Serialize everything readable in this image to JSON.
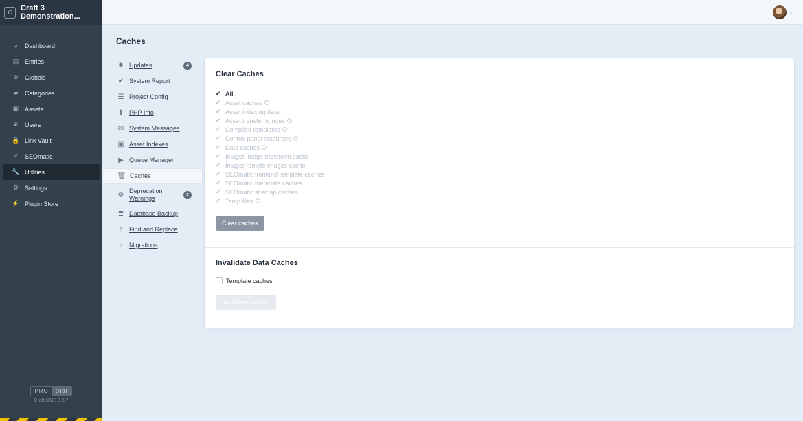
{
  "site": {
    "logo_letter": "C",
    "name_line1": "Craft 3",
    "name_line2": "Demonstration..."
  },
  "nav": [
    {
      "label": "Dashboard",
      "icon": "dashboard-icon",
      "glyph": "◕"
    },
    {
      "label": "Entries",
      "icon": "entries-icon",
      "glyph": "▤"
    },
    {
      "label": "Globals",
      "icon": "globe-icon",
      "glyph": "⊕"
    },
    {
      "label": "Categories",
      "icon": "folder-icon",
      "glyph": "▰"
    },
    {
      "label": "Assets",
      "icon": "image-icon",
      "glyph": "▣"
    },
    {
      "label": "Users",
      "icon": "users-icon",
      "glyph": "❦"
    },
    {
      "label": "Link Vault",
      "icon": "lock-icon",
      "glyph": "🔒"
    },
    {
      "label": "SEOmatic",
      "icon": "seomatic-icon",
      "glyph": "✐"
    },
    {
      "label": "Utilities",
      "icon": "wrench-icon",
      "glyph": "🔧"
    },
    {
      "label": "Settings",
      "icon": "gear-icon",
      "glyph": "⚙"
    },
    {
      "label": "Plugin Store",
      "icon": "plug-icon",
      "glyph": "⚡"
    }
  ],
  "edition": {
    "pro": "PRO",
    "trial": "trial",
    "version": "Craft CMS 3.5.7"
  },
  "page_title": "Caches",
  "utilities": [
    {
      "label": "Updates",
      "icon": "burst-icon",
      "glyph": "✹",
      "badge": "4"
    },
    {
      "label": "System Report",
      "icon": "check-icon",
      "glyph": "✔"
    },
    {
      "label": "Project Config",
      "icon": "sliders-icon",
      "glyph": "☰"
    },
    {
      "label": "PHP Info",
      "icon": "info-icon",
      "glyph": "ℹ"
    },
    {
      "label": "System Messages",
      "icon": "envelope-icon",
      "glyph": "✉"
    },
    {
      "label": "Asset Indexes",
      "icon": "image-icon",
      "glyph": "▣"
    },
    {
      "label": "Queue Manager",
      "icon": "play-icon",
      "glyph": "▶"
    },
    {
      "label": "Caches",
      "icon": "trash-icon",
      "glyph": "🗑"
    },
    {
      "label_line1": "Deprecation",
      "label_line2": "Warnings",
      "icon": "bug-icon",
      "glyph": "☸",
      "badge": "2"
    },
    {
      "label": "Database Backup",
      "icon": "database-icon",
      "glyph": "≣"
    },
    {
      "label": "Find and Replace",
      "icon": "wand-icon",
      "glyph": "⚚"
    },
    {
      "label": "Migrations",
      "icon": "arrow-up-icon",
      "glyph": "↑"
    }
  ],
  "clear_caches": {
    "title": "Clear Caches",
    "all_label": "All",
    "options": [
      {
        "label": "Asset caches",
        "info": true
      },
      {
        "label": "Asset indexing data",
        "info": false
      },
      {
        "label": "Asset transform index",
        "info": true
      },
      {
        "label": "Compiled templates",
        "info": true
      },
      {
        "label": "Control panel resources",
        "info": true
      },
      {
        "label": "Data caches",
        "info": true
      },
      {
        "label": "Imager image transform cache",
        "info": false
      },
      {
        "label": "Imager remote images cache",
        "info": false
      },
      {
        "label": "SEOmatic frontend template caches",
        "info": false
      },
      {
        "label": "SEOmatic metadata caches",
        "info": false
      },
      {
        "label": "SEOmatic sitemap caches",
        "info": false
      },
      {
        "label": "Temp files",
        "info": true
      }
    ],
    "button": "Clear caches"
  },
  "invalidate": {
    "title": "Invalidate Data Caches",
    "option": "Template caches",
    "button": "Invalidate caches"
  }
}
